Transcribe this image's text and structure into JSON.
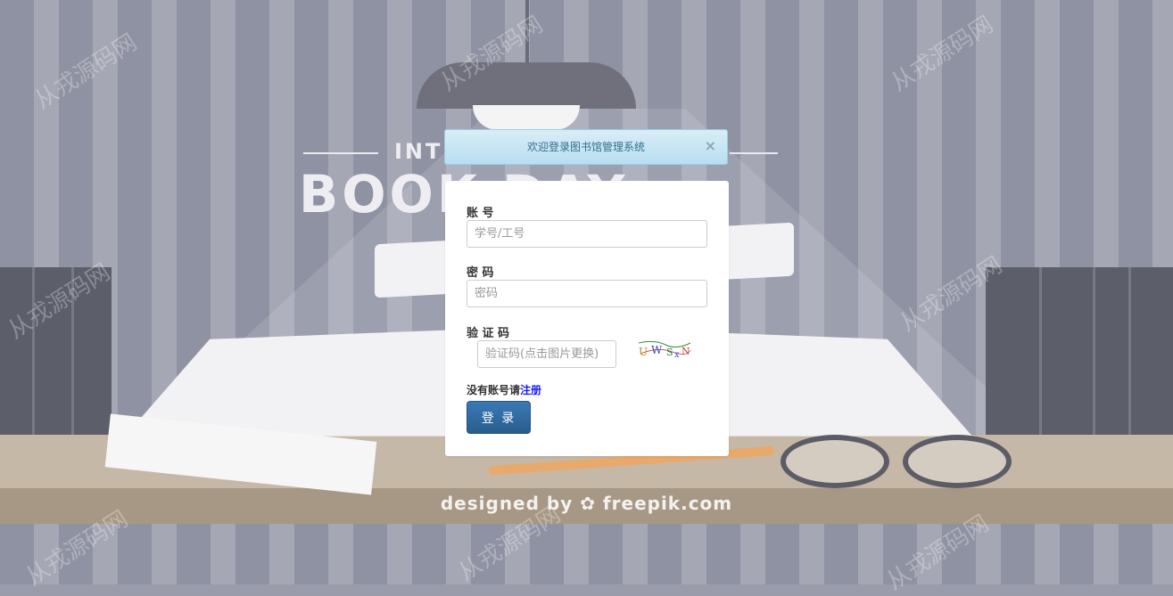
{
  "background": {
    "poster_title_small": "INT",
    "poster_title_big": "BOOK DAY",
    "credit": "designed by ✿ freepik.com",
    "watermark": "从戎源码网"
  },
  "alert": {
    "message": "欢迎登录图书馆管理系统",
    "close_symbol": "×"
  },
  "form": {
    "account_label": "账 号",
    "account_placeholder": "学号/工号",
    "password_label": "密 码",
    "password_placeholder": "密码",
    "captcha_label": "验 证 码",
    "captcha_placeholder": "验证码(点击图片更换)",
    "captcha_text": "UWSxN",
    "register_prompt": "没有账号请",
    "register_link": "注册",
    "login_button": "登 录"
  },
  "colors": {
    "alert_bg": "#d9edf7",
    "alert_text": "#31708f",
    "button_primary": "#2f6da3",
    "link": "#1a1aff"
  }
}
